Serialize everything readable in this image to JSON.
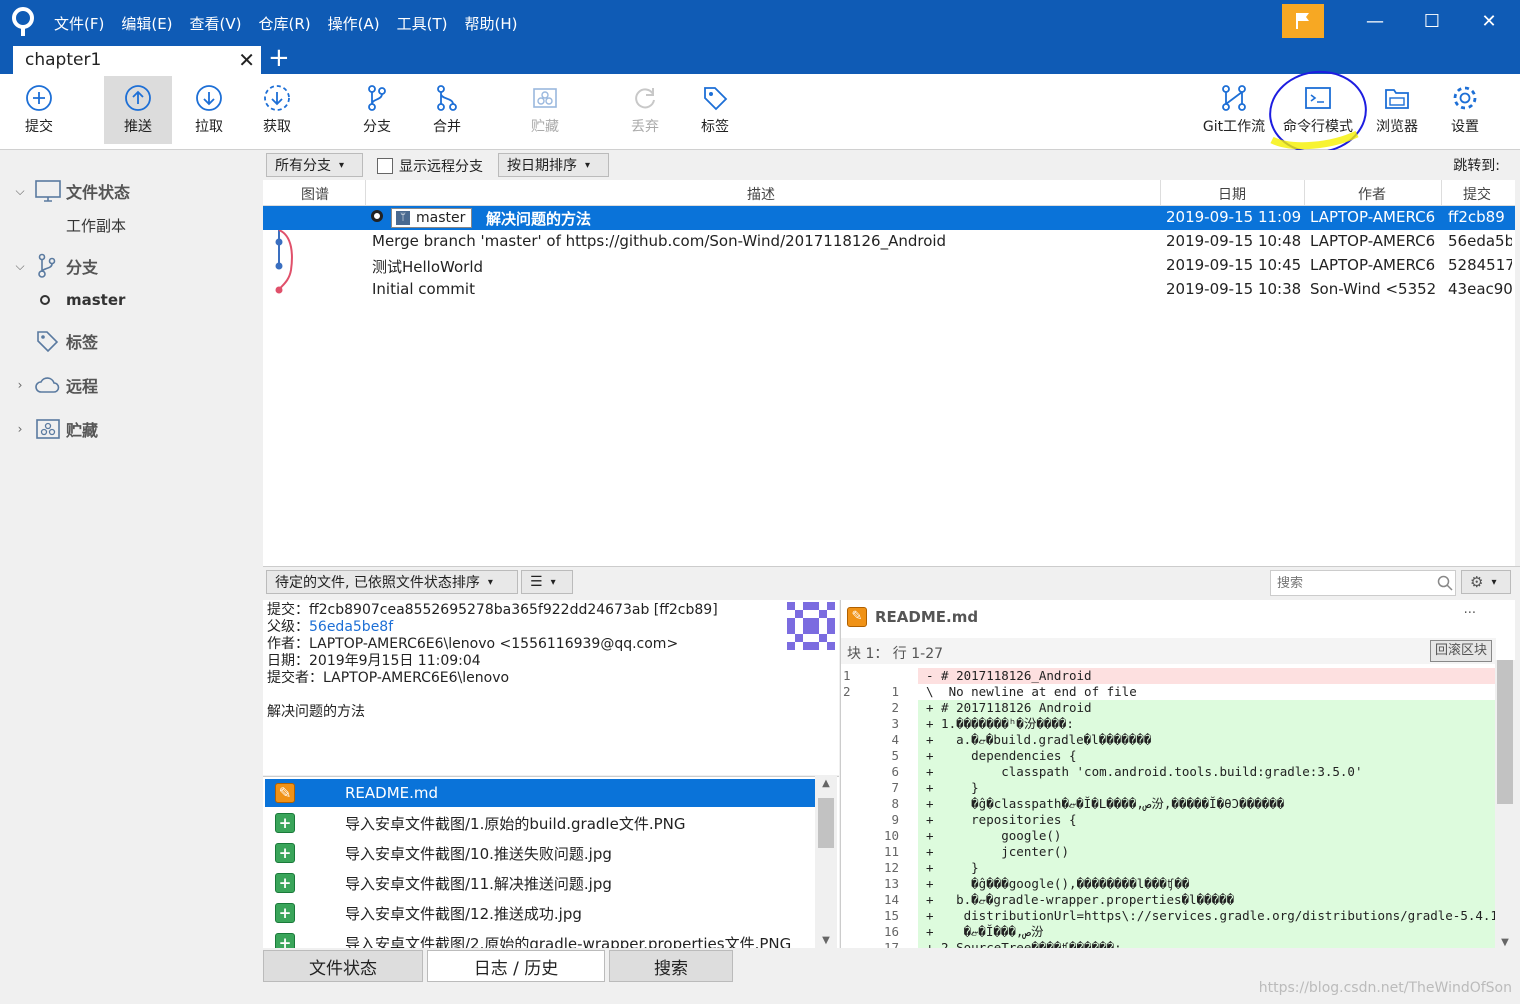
{
  "menu": [
    "文件(F)",
    "编辑(E)",
    "查看(V)",
    "仓库(R)",
    "操作(A)",
    "工具(T)",
    "帮助(H)"
  ],
  "window": {
    "minimize": "—",
    "maximize": "☐",
    "close": "✕"
  },
  "tab": {
    "title": "chapter1",
    "close": "✕",
    "new": "+"
  },
  "toolbar": {
    "commit": "提交",
    "push": "推送",
    "pull": "拉取",
    "fetch": "获取",
    "branch": "分支",
    "merge": "合并",
    "stash": "贮藏",
    "discard": "丢弃",
    "tag": "标签",
    "git_flow": "Git工作流",
    "terminal": "命令行模式",
    "explorer": "浏览器",
    "settings": "设置"
  },
  "sidebar": {
    "file_status": "文件状态",
    "working_copy": "工作副本",
    "branches": "分支",
    "master": "master",
    "tags": "标签",
    "remotes": "远程",
    "stashes": "贮藏"
  },
  "filter": {
    "all_branches": "所有分支",
    "show_remote": "显示远程分支",
    "sort": "按日期排序",
    "jump_to": "跳转到:"
  },
  "columns": {
    "graph": "图谱",
    "description": "描述",
    "date": "日期",
    "author": "作者",
    "commit": "提交"
  },
  "commits": [
    {
      "branch": "master",
      "desc": "解决问题的方法",
      "date": "2019-09-15 11:09",
      "author": "LAPTOP-AMERC6",
      "hash": "ff2cb89"
    },
    {
      "desc": "Merge branch 'master' of https://github.com/Son-Wind/2017118126_Android",
      "date": "2019-09-15 10:48",
      "author": "LAPTOP-AMERC6",
      "hash": "56eda5b"
    },
    {
      "desc": "测试HelloWorld",
      "date": "2019-09-15 10:45",
      "author": "LAPTOP-AMERC6",
      "hash": "5284517"
    },
    {
      "desc": "Initial commit",
      "date": "2019-09-15 10:38",
      "author": "Son-Wind <5352",
      "hash": "43eac90"
    }
  ],
  "pending": {
    "sort_label": "待定的文件, 已依照文件状态排序",
    "search_placeholder": "搜索"
  },
  "detail": {
    "commit_label": "提交：",
    "commit_value": "ff2cb8907cea8552695278ba365f922dd24673ab [ff2cb89]",
    "parent_label": "父级：",
    "parent_value": "56eda5be8f",
    "author_label": "作者：",
    "author_value": "LAPTOP-AMERC6E6\\lenovo <1556116939@qq.com>",
    "date_label": "日期：",
    "date_value": "2019年9月15日 11:09:04",
    "committer_label": "提交者：",
    "committer_value": "LAPTOP-AMERC6E6\\lenovo",
    "message": "解决问题的方法"
  },
  "files": [
    {
      "name": "README.md",
      "status": "modified"
    },
    {
      "name": "导入安卓文件截图/1.原始的build.gradle文件.PNG",
      "status": "added"
    },
    {
      "name": "导入安卓文件截图/10.推送失败问题.jpg",
      "status": "added"
    },
    {
      "name": "导入安卓文件截图/11.解决推送问题.jpg",
      "status": "added"
    },
    {
      "name": "导入安卓文件截图/12.推送成功.jpg",
      "status": "added"
    },
    {
      "name": "导入安卓文件截图/2.原始的gradle-wrapper.properties文件.PNG",
      "status": "added"
    }
  ],
  "diff": {
    "file": "README.md",
    "hunk": "块 1： 行 1-27",
    "revert_hunk": "回滚区块",
    "more": "···",
    "lines": [
      {
        "o": "1",
        "n": "",
        "t": "del",
        "c": "- # 2017118126_Android"
      },
      {
        "o": "2",
        "n": "1",
        "t": "ctx",
        "c": "\\  No newline at end of file"
      },
      {
        "o": "",
        "n": "2",
        "t": "add",
        "c": "+ # 2017118126 Android"
      },
      {
        "o": "",
        "n": "3",
        "t": "add",
        "c": "+ 1.�������ʰ�汾����:"
      },
      {
        "o": "",
        "n": "4",
        "t": "add",
        "c": "+   a.�ޏ�build.gradle�l�������"
      },
      {
        "o": "",
        "n": "5",
        "t": "add",
        "c": "+     dependencies {"
      },
      {
        "o": "",
        "n": "6",
        "t": "add",
        "c": "+         classpath 'com.android.tools.build:gradle:3.5.0'"
      },
      {
        "o": "",
        "n": "7",
        "t": "add",
        "c": "+     }"
      },
      {
        "o": "",
        "n": "8",
        "t": "add",
        "c": "+     �ĝ�classpath�ޏ�Ĭ�L����,ص汾,�����Ĭ�θϽ������"
      },
      {
        "o": "",
        "n": "9",
        "t": "add",
        "c": "+     repositories {"
      },
      {
        "o": "",
        "n": "10",
        "t": "add",
        "c": "+         google()"
      },
      {
        "o": "",
        "n": "11",
        "t": "add",
        "c": "+         jcenter()"
      },
      {
        "o": "",
        "n": "12",
        "t": "add",
        "c": "+     }"
      },
      {
        "o": "",
        "n": "13",
        "t": "add",
        "c": "+     �ĝ���google(),��������l���ʧ��"
      },
      {
        "o": "",
        "n": "14",
        "t": "add",
        "c": "+   b.�ޏ�gradle-wrapper.properties�l�����"
      },
      {
        "o": "",
        "n": "15",
        "t": "add",
        "c": "+    distributionUrl=https\\://services.gradle.org/distributions/gradle-5.4.1"
      },
      {
        "o": "",
        "n": "16",
        "t": "add",
        "c": "+    �ޏ�Ĭ���,ص汾"
      },
      {
        "o": "",
        "n": "17",
        "t": "add",
        "c": "+ 2.SourceTree����ʧ������:"
      }
    ]
  },
  "bottom_tabs": [
    "文件状态",
    "日志 / 历史",
    "搜索"
  ],
  "watermark": "https://blog.csdn.net/TheWindOfSon"
}
